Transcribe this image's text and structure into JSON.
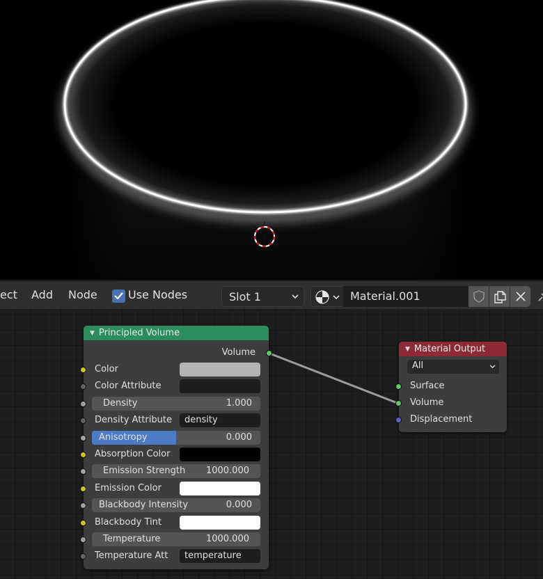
{
  "viewport": {
    "object": "cylinder-volume-render",
    "cursor": "3d-cursor"
  },
  "header": {
    "menus": [
      "ect",
      "Add",
      "Node"
    ],
    "use_nodes": {
      "label": "Use Nodes",
      "checked": true
    },
    "slot": {
      "value": "Slot 1"
    },
    "material_browse_icon": "material-sphere-icon",
    "material_name": "Material.001",
    "buttons": [
      "fake-user-shield-icon",
      "duplicate-icon",
      "unlink-x-icon"
    ],
    "accent": "#4772b3"
  },
  "nodes": {
    "principled_volume": {
      "title": "Principled Volume",
      "header_color": "#2c8c5c",
      "output": {
        "label": "Volume",
        "socket_color": "#63c763"
      },
      "inputs": [
        {
          "label": "Color",
          "type": "color",
          "value": "#b4b4b4",
          "socket_color": "#c7c729"
        },
        {
          "label": "Color Attribute",
          "type": "text",
          "value": "",
          "socket_color": "#636363"
        },
        {
          "label": "Density",
          "type": "slider",
          "value": "1.000",
          "socket_color": "#a1a1a1"
        },
        {
          "label": "Density Attribute",
          "type": "text",
          "value": "density",
          "socket_color": "#636363"
        },
        {
          "label": "Anisotropy",
          "type": "factor",
          "value": "0.000",
          "fill_fraction": 0.5,
          "socket_color": "#a1a1a1"
        },
        {
          "label": "Absorption Color",
          "type": "color",
          "value": "#000000",
          "socket_color": "#c7c729"
        },
        {
          "label": "Emission Strength",
          "type": "slider",
          "value": "1000.000",
          "socket_color": "#a1a1a1"
        },
        {
          "label": "Emission Color",
          "type": "color",
          "value": "#ffffff",
          "socket_color": "#c7c729"
        },
        {
          "label": "Blackbody Intensity",
          "type": "slider",
          "value": "0.000",
          "socket_color": "#a1a1a1"
        },
        {
          "label": "Blackbody Tint",
          "type": "color",
          "value": "#ffffff",
          "socket_color": "#c7c729"
        },
        {
          "label": "Temperature",
          "type": "slider",
          "value": "1000.000",
          "socket_color": "#a1a1a1"
        },
        {
          "label": "Temperature Att",
          "type": "text",
          "value": "temperature",
          "socket_color": "#636363"
        }
      ]
    },
    "material_output": {
      "title": "Material Output",
      "header_color": "#8c2a36",
      "target": "All",
      "inputs": [
        {
          "label": "Surface",
          "socket_color": "#63c763"
        },
        {
          "label": "Volume",
          "socket_color": "#63c763"
        },
        {
          "label": "Displacement",
          "socket_color": "#6363c7"
        }
      ]
    }
  },
  "links": [
    {
      "from": "Principled Volume.Volume",
      "to": "Material Output.Volume"
    }
  ]
}
